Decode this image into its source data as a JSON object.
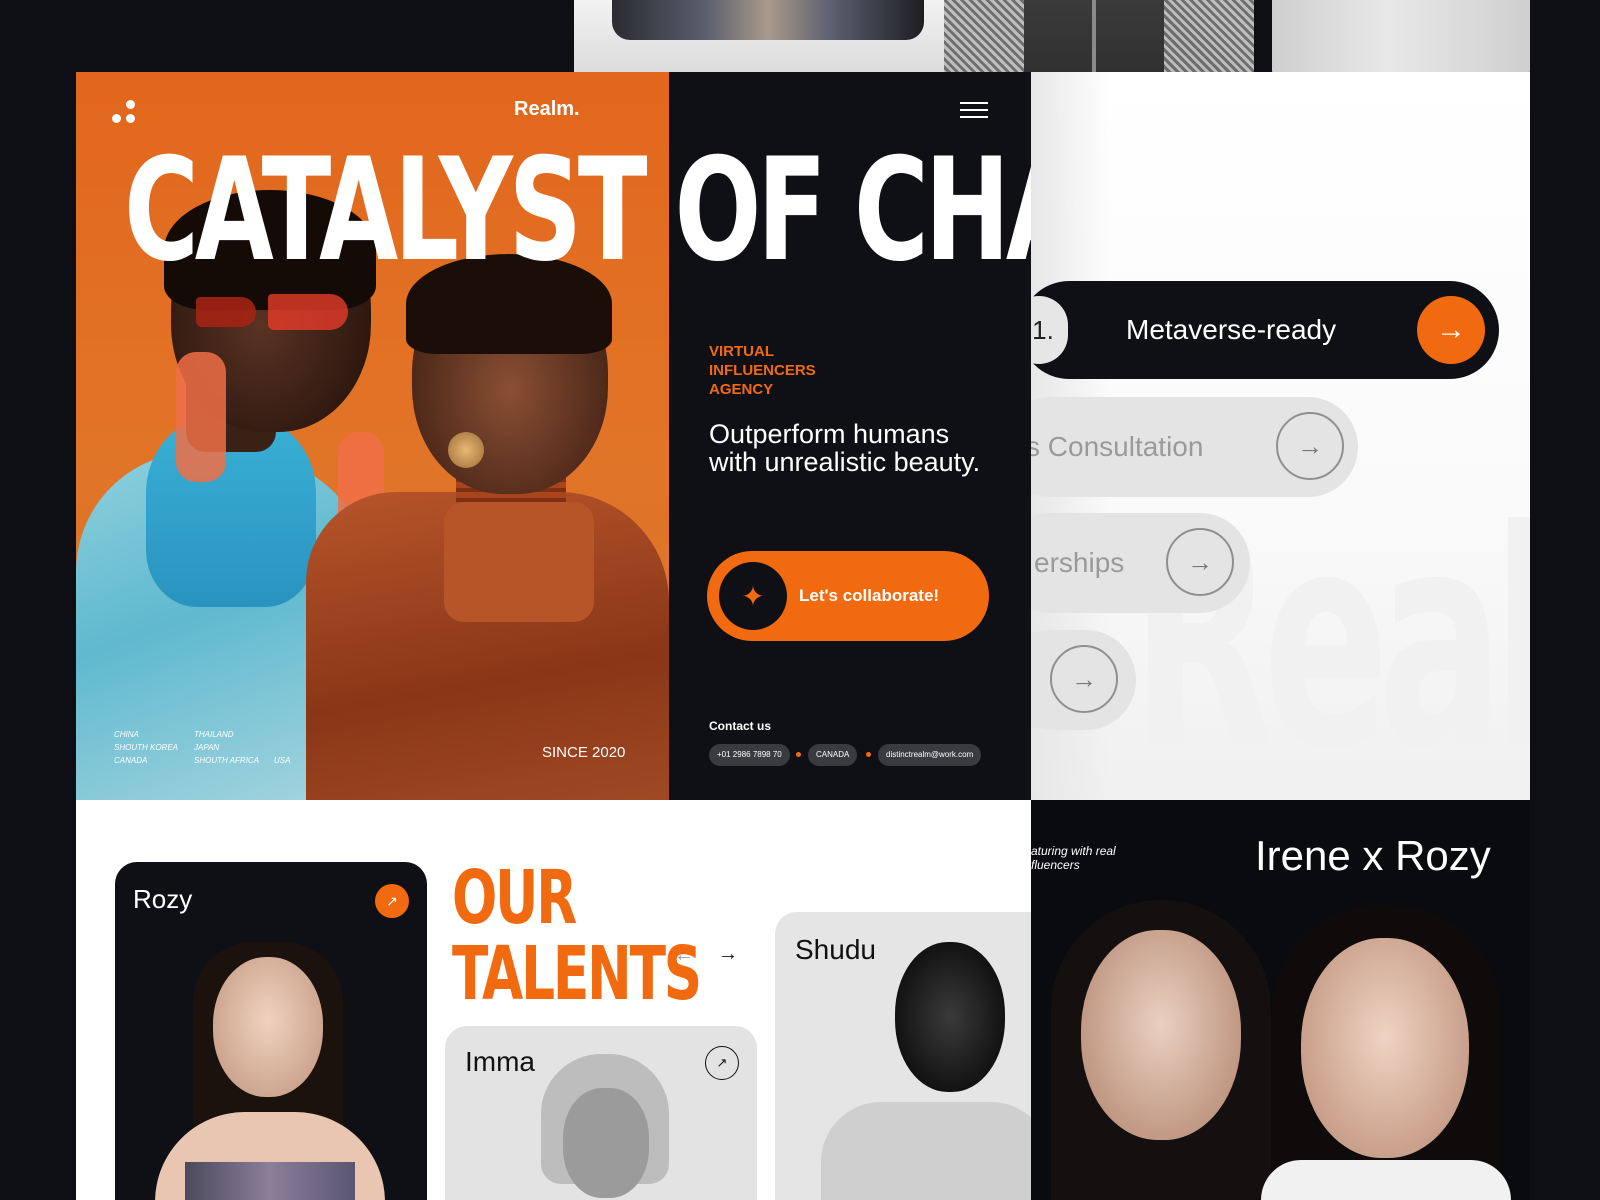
{
  "header": {
    "brand": "Realm.",
    "logo_icon": "three-dots-logo-icon",
    "menu_icon": "hamburger-menu-icon"
  },
  "hero": {
    "headline": "CATALYST OF CHANGE",
    "tagline_lines": [
      "VIRTUAL",
      "INFLUENCERS",
      "AGENCY"
    ],
    "subheadline": "Outperform humans with unrealistic beauty.",
    "cta_label": "Let's collaborate!",
    "cta_icon": "sparkle-star-icon",
    "countries_col1": [
      "CHINA",
      "SHOUTH KOREA",
      "CANADA"
    ],
    "countries_col2": [
      "THAILAND",
      "JAPAN",
      "SHOUTH AFRICA"
    ],
    "countries_col3": [
      "USA"
    ],
    "since": "SINCE 2020",
    "contact_heading": "Contact us",
    "contact_phone": "+01 2986 7898 70",
    "contact_country": "CANADA",
    "contact_email": "distinctrealm@work.com"
  },
  "services": {
    "items": [
      {
        "number": "1.",
        "label": "Metaverse-ready"
      },
      {
        "label": "ss Consultation"
      },
      {
        "label": "erships"
      },
      {
        "label": ""
      }
    ],
    "watermark": "Realm",
    "arrow_icon": "arrow-right-icon"
  },
  "talents": {
    "heading_line1": "OUR",
    "heading_line2": "TALENTS",
    "prev_icon": "arrow-left-icon",
    "next_icon": "arrow-right-icon",
    "cards": [
      {
        "name": "Rozy"
      },
      {
        "name": "Imma"
      },
      {
        "name": "Shudu"
      }
    ],
    "card_arrow_icon": "arrow-up-right-icon"
  },
  "collab": {
    "featuring_lines": [
      "aturing with real",
      "fluencers"
    ],
    "title": "Irene x Rozy"
  },
  "colors": {
    "accent": "#f26a10",
    "dark": "#0f1015",
    "background": "#0d0f14"
  }
}
